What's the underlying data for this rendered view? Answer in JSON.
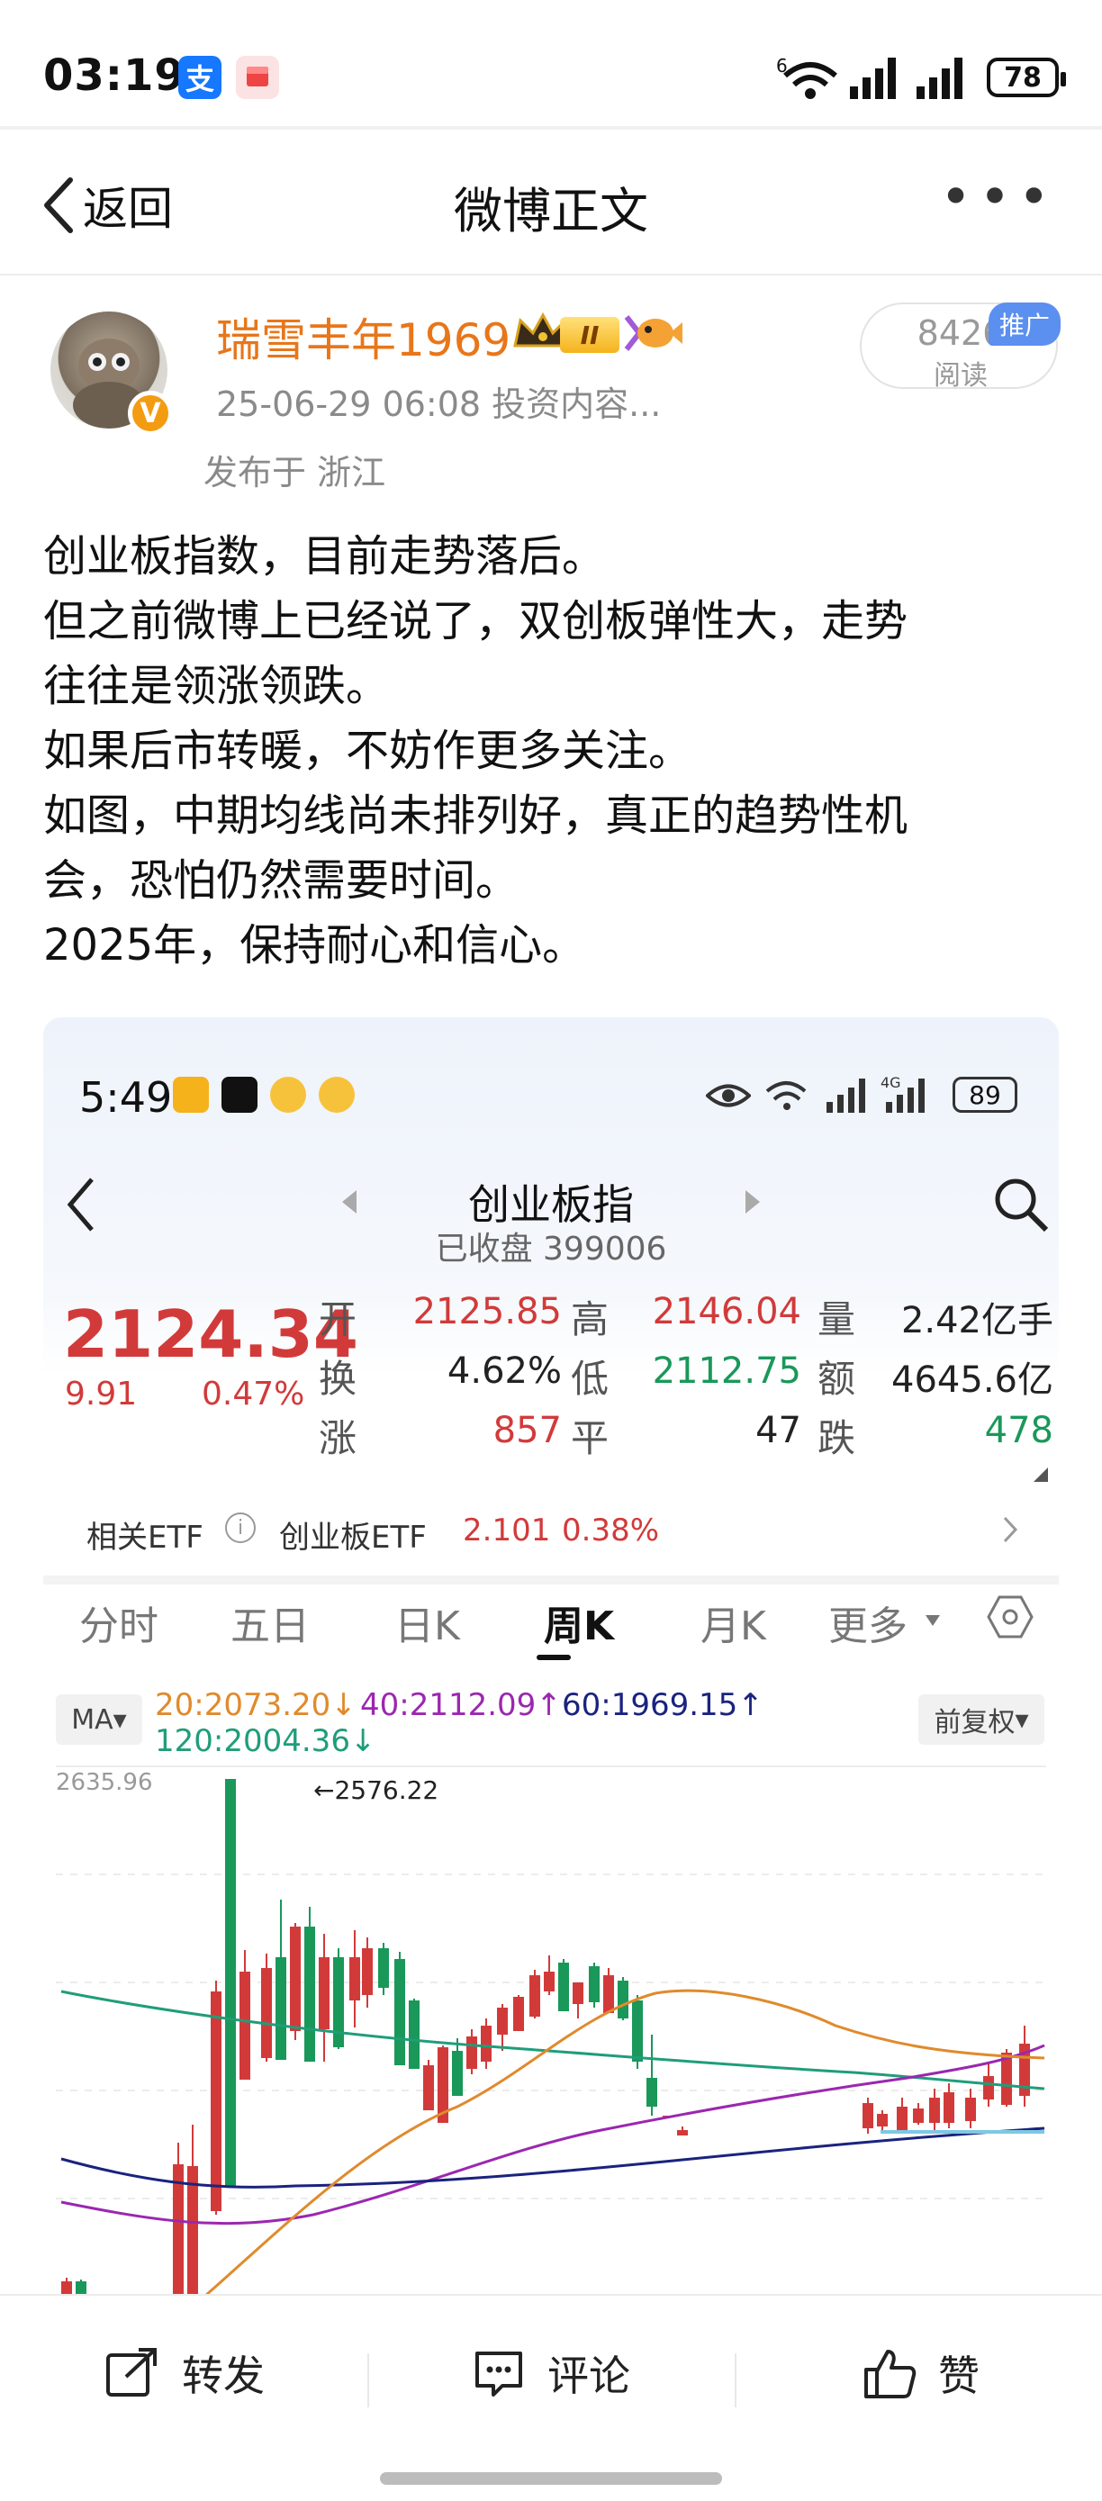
{
  "status_bar": {
    "time": "03:19",
    "battery": "78"
  },
  "nav": {
    "back_label": "返回",
    "title": "微博正文"
  },
  "post": {
    "username": "瑞雪丰年1969",
    "meta": "25-06-29 06:08  投资内容...",
    "location": "发布于 浙江",
    "read_count": "8426",
    "read_label": "阅读",
    "promo_tag": "推广",
    "body_lines": [
      "创业板指数，目前走势落后。",
      "但之前微博上已经说了，双创板弹性大，走势",
      "往往是领涨领跌。",
      "如果后市转暖，不妨作更多关注。",
      "如图，中期均线尚未排列好，真正的趋势性机",
      "会，恐怕仍然需要时间。",
      "2025年，保持耐心和信心。"
    ]
  },
  "embed": {
    "time": "5:49",
    "battery": "89",
    "title": "创业板指",
    "subtitle": "已收盘 399006",
    "price": "2124.34",
    "change": "9.91",
    "change_pct": "0.47%",
    "quote": {
      "open_label": "开",
      "open": "2125.85",
      "high_label": "高",
      "high": "2146.04",
      "volume_label": "量",
      "volume": "2.42亿手",
      "turnover_label": "换",
      "turnover": "4.62%",
      "low_label": "低",
      "low": "2112.75",
      "amount_label": "额",
      "amount": "4645.6亿",
      "up_label": "涨",
      "up": "857",
      "flat_label": "平",
      "flat": "47",
      "down_label": "跌",
      "down": "478"
    },
    "etf": {
      "label": "相关ETF",
      "name": "创业板ETF",
      "price": "2.101",
      "pct": "0.38%"
    },
    "tabs": [
      "分时",
      "五日",
      "日K",
      "周K",
      "月K",
      "更多"
    ],
    "ma_button": "MA",
    "fq_button": "前复权",
    "ma20": "20:2073.20↓",
    "ma40": "40:2112.09↑",
    "ma60": "60:1969.15↑",
    "ma120": "120:2004.36↓",
    "colors": {
      "up": "#d23a3a",
      "down": "#19985a",
      "ma20": "#e08a2c",
      "ma40": "#9b27b0",
      "ma60": "#1a237e",
      "ma120": "#1f9d7a"
    }
  },
  "chart_data": {
    "type": "candlestick",
    "title": "创业板指 周K",
    "y_top_label": "2635.96",
    "peak_annotation": "←2576.22",
    "ma_series": [
      "MA20",
      "MA40",
      "MA60",
      "MA120"
    ]
  },
  "bottom_bar": {
    "repost": "转发",
    "comment": "评论",
    "like": "赞"
  }
}
